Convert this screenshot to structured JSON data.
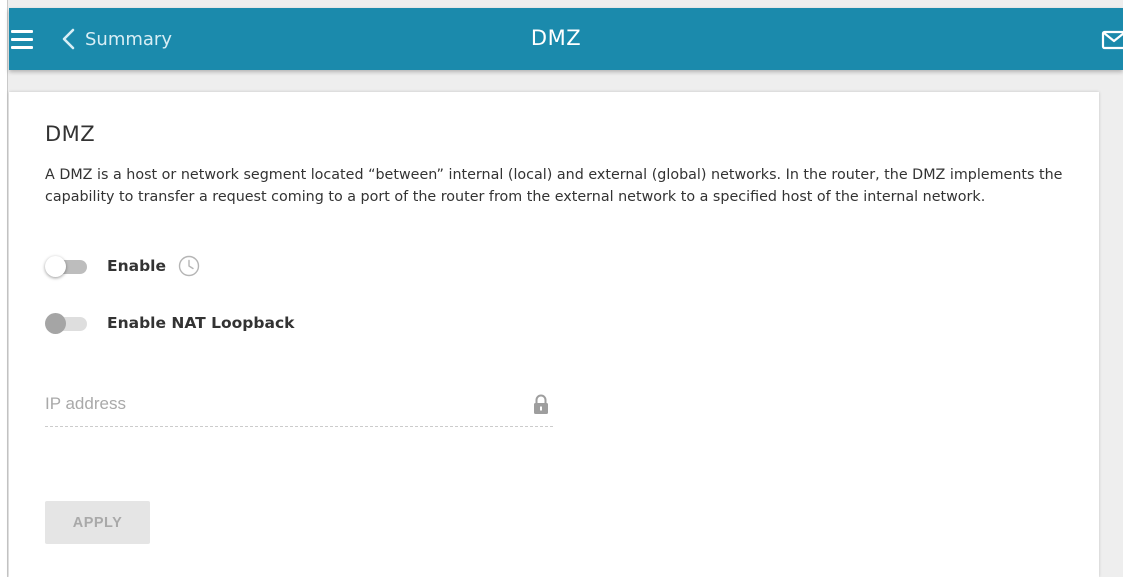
{
  "header": {
    "back_label": "Summary",
    "title": "DMZ",
    "icons": {
      "menu": "hamburger-icon",
      "back": "chevron-left-icon",
      "notifications": "mail-icon"
    }
  },
  "colors": {
    "header_bg": "#1b8aac",
    "page_bg": "#eeeeee",
    "card_bg": "#ffffff",
    "text": "#333333",
    "placeholder": "#a9a9a9",
    "button_disabled_bg": "#e5e5e5"
  },
  "section": {
    "title": "DMZ",
    "description": "A DMZ is a host or network segment located “between” internal (local) and external (global) networks. In the router, the DMZ implements the capability to transfer a request coming to a port of the router from the external network to a specified host of the internal network."
  },
  "toggles": {
    "enable": {
      "label": "Enable",
      "checked": false,
      "disabled": false,
      "icon": "clock-icon"
    },
    "nat_loopback": {
      "label": "Enable NAT Loopback",
      "checked": false,
      "disabled": true
    }
  },
  "ip_field": {
    "placeholder": "IP address",
    "value": "",
    "icon": "lock-icon"
  },
  "apply_button": {
    "label": "APPLY",
    "disabled": true
  }
}
